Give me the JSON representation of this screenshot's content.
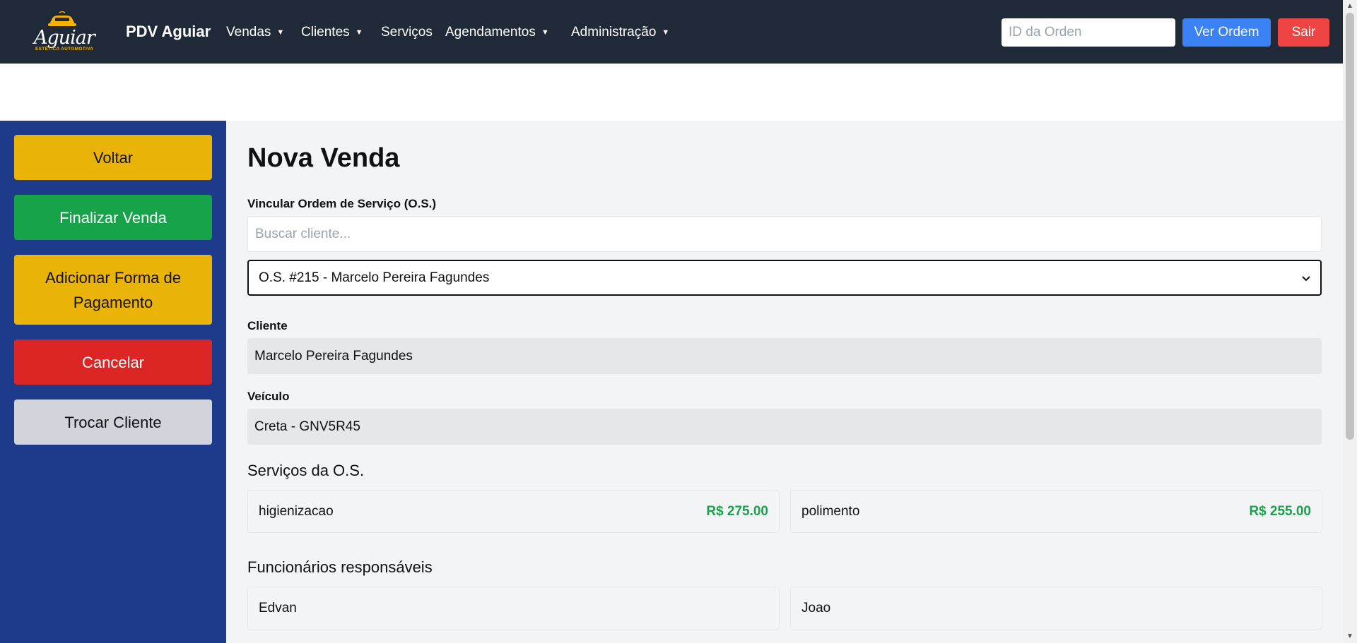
{
  "navbar": {
    "logo_text": "Aguiar",
    "logo_subtitle": "ESTÉTICA AUTOMOTIVA",
    "brand": "PDV Aguiar",
    "menu": [
      {
        "label": "Vendas"
      },
      {
        "label": "Clientes"
      },
      {
        "label": "Serviços"
      },
      {
        "label": "Agendamentos"
      },
      {
        "label": "Administração"
      }
    ],
    "order_placeholder": "ID da Orden",
    "ver_ordem": "Ver Ordem",
    "sair": "Sair",
    "colors": {
      "bg": "#1f2937",
      "ver": "#3b82f6",
      "sair": "#ef4444"
    }
  },
  "sidebar": {
    "buttons": [
      {
        "label": "Voltar",
        "color": "#eab308"
      },
      {
        "label": "Finalizar Venda",
        "color": "#16a34a"
      },
      {
        "label": "Adicionar Forma de Pagamento",
        "color": "#eab308"
      },
      {
        "label": "Cancelar",
        "color": "#dc2626"
      },
      {
        "label": "Trocar Cliente",
        "color": "#d1d5db"
      }
    ],
    "bg": "#1e3a8a"
  },
  "main": {
    "title": "Nova Venda",
    "link_label": "Vincular Ordem de Serviço (O.S.)",
    "search_placeholder": "Buscar cliente...",
    "os_selected": "O.S. #215 - Marcelo Pereira Fagundes",
    "cliente_label": "Cliente",
    "cliente_value": "Marcelo Pereira Fagundes",
    "veiculo_label": "Veículo",
    "veiculo_value": "Creta - GNV5R45",
    "servicos_title": "Serviços da O.S.",
    "servicos": [
      {
        "name": "higienizacao",
        "price": "R$ 275.00"
      },
      {
        "name": "polimento",
        "price": "R$ 255.00"
      }
    ],
    "funcionarios_title": "Funcionários responsáveis",
    "funcionarios": [
      "Edvan",
      "Joao"
    ]
  }
}
